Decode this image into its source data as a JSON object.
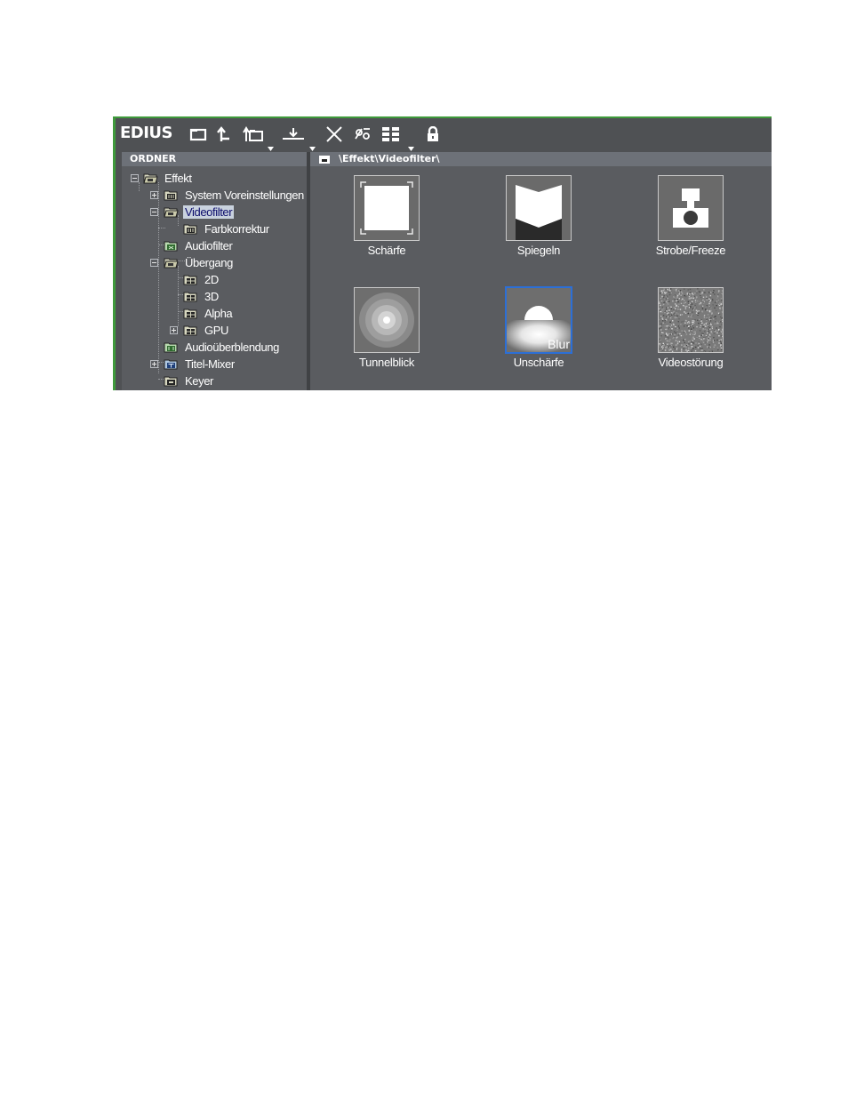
{
  "app": {
    "logo": "EDIUS"
  },
  "toolbar": {
    "buttons": [
      {
        "name": "folder-icon"
      },
      {
        "name": "up-arrow-icon"
      },
      {
        "name": "new-folder-icon"
      },
      {
        "name": "import-icon"
      },
      {
        "name": "delete-icon"
      },
      {
        "name": "properties-icon"
      },
      {
        "name": "view-icon"
      },
      {
        "name": "lock-icon"
      }
    ]
  },
  "folder_pane": {
    "header": "ORDNER",
    "tree": [
      {
        "label": "Effekt",
        "expander": "minus"
      },
      {
        "label": "System Voreinstellungen",
        "expander": "plus"
      },
      {
        "label": "Videofilter",
        "expander": "minus",
        "selected": true
      },
      {
        "label": "Farbkorrektur"
      },
      {
        "label": "Audiofilter"
      },
      {
        "label": "Übergang",
        "expander": "minus"
      },
      {
        "label": "2D"
      },
      {
        "label": "3D"
      },
      {
        "label": "Alpha"
      },
      {
        "label": "GPU",
        "expander": "plus"
      },
      {
        "label": "Audioüberblendung"
      },
      {
        "label": "Titel-Mixer",
        "expander": "plus"
      },
      {
        "label": "Keyer"
      }
    ]
  },
  "content_pane": {
    "path": "\\Effekt\\Videofilter\\",
    "effects": [
      {
        "label": "Schärfe",
        "icon": "sharpen-icon"
      },
      {
        "label": "Spiegeln",
        "icon": "mirror-icon"
      },
      {
        "label": "Strobe/Freeze",
        "icon": "camera-icon"
      },
      {
        "label": "Tunnelblick",
        "icon": "tunnel-icon"
      },
      {
        "label": "Unschärfe",
        "icon": "blur-icon",
        "overlay": "Blur",
        "selected": true
      },
      {
        "label": "Videostörung",
        "icon": "noise-icon"
      }
    ]
  }
}
